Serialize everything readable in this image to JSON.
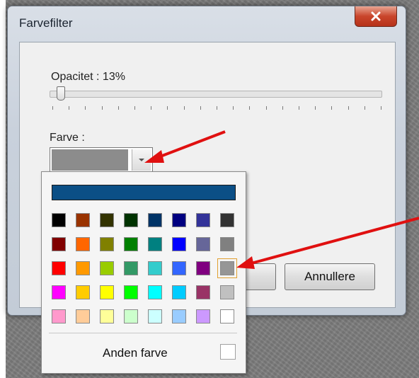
{
  "window": {
    "title": "Farvefilter"
  },
  "opacity": {
    "label": "Opacitet : 13%",
    "value_percent": 13
  },
  "color": {
    "label": "Farve :",
    "selected_color": "#8c8c8c"
  },
  "buttons": {
    "cancel": "Annullere"
  },
  "palette": {
    "top_color": "#0b4f86",
    "rows": [
      [
        "#000000",
        "#993300",
        "#333300",
        "#003300",
        "#003366",
        "#000080",
        "#333399",
        "#333333"
      ],
      [
        "#800000",
        "#FF6600",
        "#808000",
        "#008000",
        "#008080",
        "#0000FF",
        "#666699",
        "#808080"
      ],
      [
        "#FF0000",
        "#FF9900",
        "#99CC00",
        "#339966",
        "#33CCCC",
        "#3366FF",
        "#800080",
        "#969696"
      ],
      [
        "#FF00FF",
        "#FFCC00",
        "#FFFF00",
        "#00FF00",
        "#00FFFF",
        "#00CCFF",
        "#993366",
        "#C0C0C0"
      ],
      [
        "#FF99CC",
        "#FFCC99",
        "#FFFF99",
        "#CCFFCC",
        "#CCFFFF",
        "#99CCFF",
        "#CC99FF",
        "#FFFFFF"
      ]
    ],
    "selected": "#969696",
    "more_colors_label": "Anden farve"
  },
  "annotation_color": "#e01010"
}
